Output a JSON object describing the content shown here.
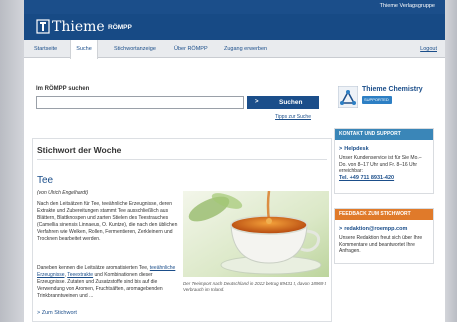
{
  "header": {
    "group_name": "Thieme Verlagsgruppe",
    "brand": "Thieme",
    "product": "RÖMPP"
  },
  "nav": {
    "tabs": [
      "Startseite",
      "Suche",
      "Stichwortanzeige",
      "Über RÖMPP",
      "Zugang erwerben"
    ],
    "active_tab": "Suche",
    "logout": "Logout"
  },
  "search": {
    "label": "Im RÖMPP suchen",
    "value": "",
    "button_arrow": ">",
    "button_label": "Suchen",
    "tips_link": "Tipps zur Suche"
  },
  "keyword": {
    "section_title": "Stichwort der Woche",
    "word": "Tee",
    "author": "(von Ulrich Engelhardt)",
    "paragraph1": "Nach den Leitsätzen für Tee, teeähnliche Erzeugnisse, deren Extrakte und Zubereitungen stammt Tee ausschließlich aus Blättern, Blattknospen und zarten Stielen des Teestrauches (Camellia sinensis Linnaeus, O. Kuntze), die nach den üblichen Verfahren wie Welken, Rollen, Fermentieren, Zerkleinern und Trocknen bearbeitet werden.",
    "paragraph2_start": "Daneben kennen die Leitsätze aromatisierten Tee,",
    "link1": "teeähnliche Erzeugnisse",
    "paragraph2_mid": ",",
    "link2": "Teeextrakte",
    "paragraph2_end": "und Kombinationen dieser Erzeugnisse. Zutaten und Zusatzstoffe sind bis auf die Verwendung von Aromen, Fruchtsäften, aromagebenden Trinkbranntweinen und ...",
    "more_link": "> Zum Stichwort",
    "caption": "Der Teeimport nach Deutschland in 2012 betrug 89431 t, davon 18969 t Verbrauch im Inland."
  },
  "sidebar": {
    "chem_name": "Thieme Chemistry",
    "chem_badge": "SUPPORTED",
    "support": {
      "heading": "KONTAKT UND SUPPORT",
      "item": "Helpdesk",
      "text": "Unser Kundenservice ist für Sie Mo.–Do. von 8–17 Uhr und Fr. 8–16 Uhr erreichbar:",
      "phone": "Tel. +49 711 8931-420"
    },
    "feedback": {
      "heading": "FEEDBACK ZUM STICHWORT",
      "item": "redaktion@roempp.com",
      "text": "Unsere Redaktion freut sich über Ihre Kommentare und beantwortet Ihre Anfragen."
    }
  },
  "colors": {
    "brand_blue": "#174a85",
    "support_blue": "#3a86b8",
    "feedback_orange": "#e07a2a"
  }
}
